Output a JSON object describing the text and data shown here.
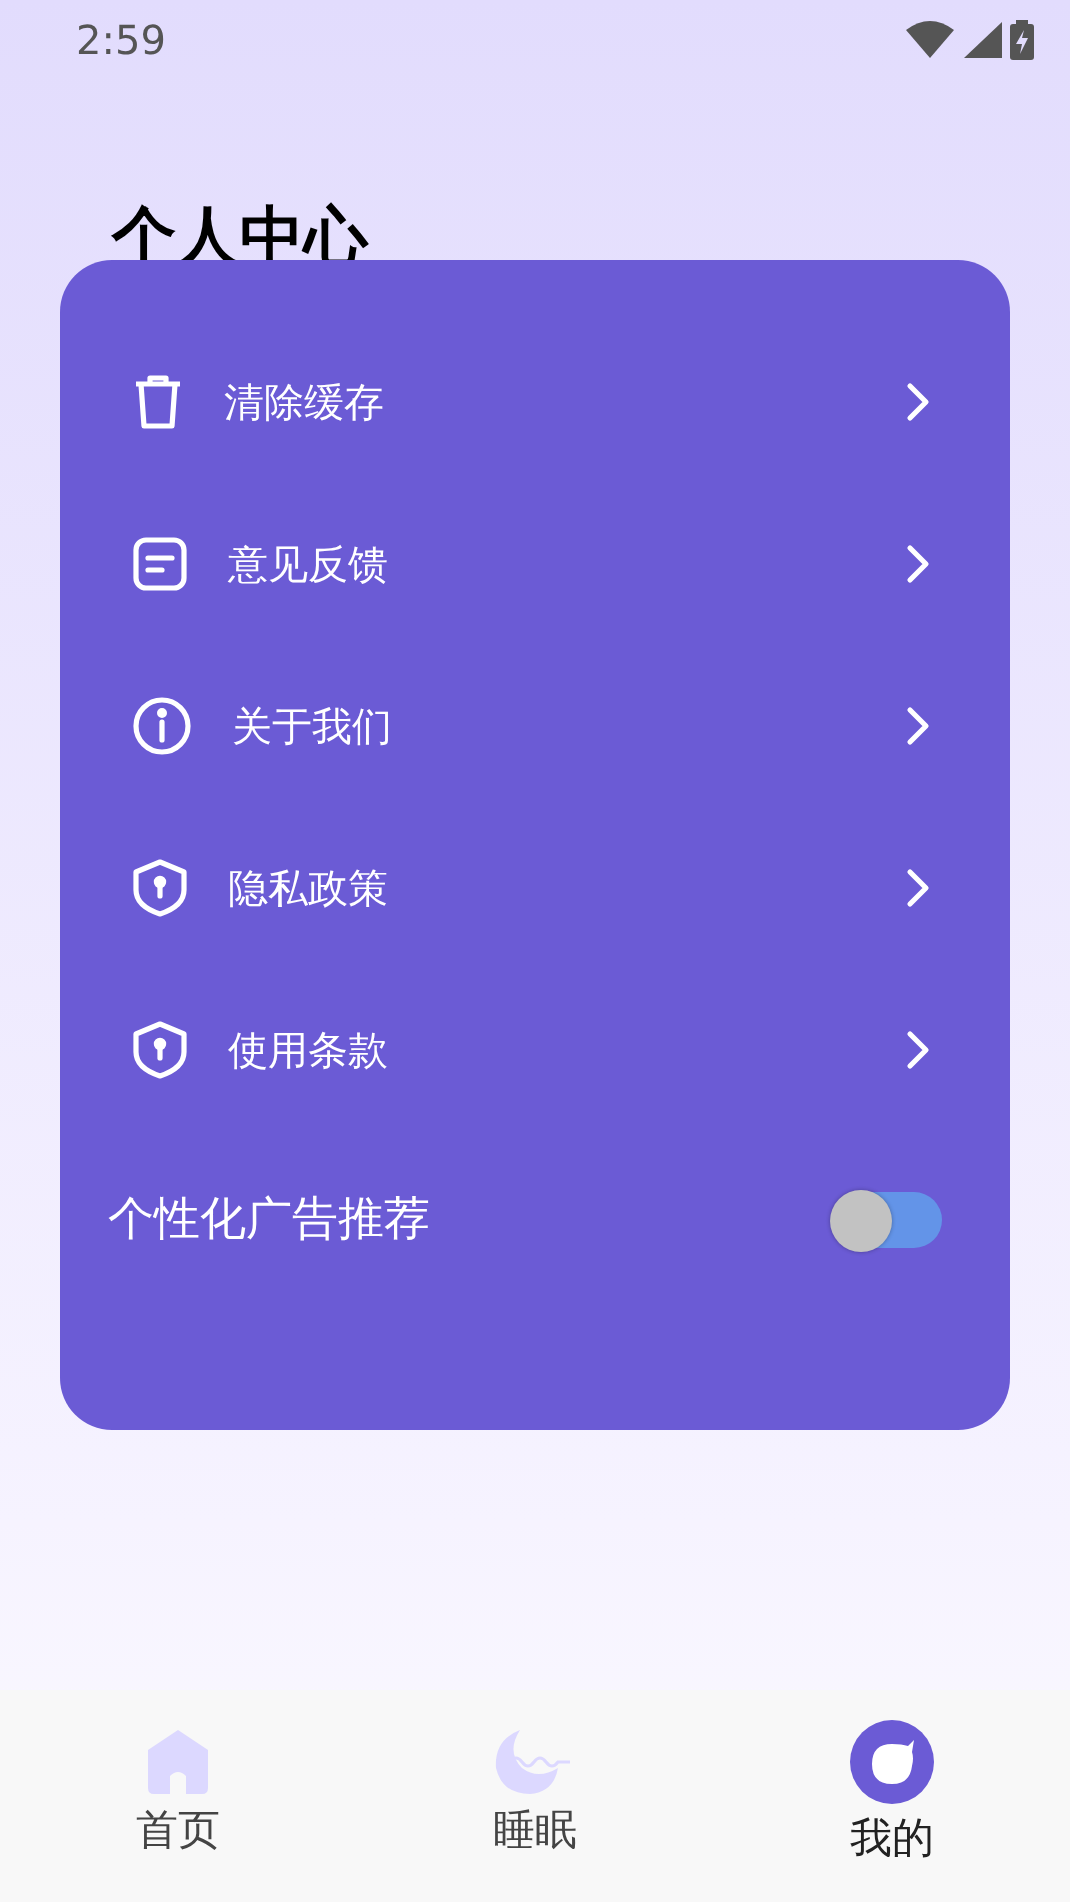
{
  "status_bar": {
    "time": "2:59"
  },
  "page_title": "个人中心",
  "menu": [
    {
      "label": "清除缓存"
    },
    {
      "label": "意见反馈"
    },
    {
      "label": "关于我们"
    },
    {
      "label": "隐私政策"
    },
    {
      "label": "使用条款"
    }
  ],
  "ad_toggle": {
    "label": "个性化广告推荐",
    "on": false
  },
  "tabs": [
    {
      "label": "首页",
      "selected": false
    },
    {
      "label": "睡眠",
      "selected": false
    },
    {
      "label": "我的",
      "selected": true
    }
  ]
}
